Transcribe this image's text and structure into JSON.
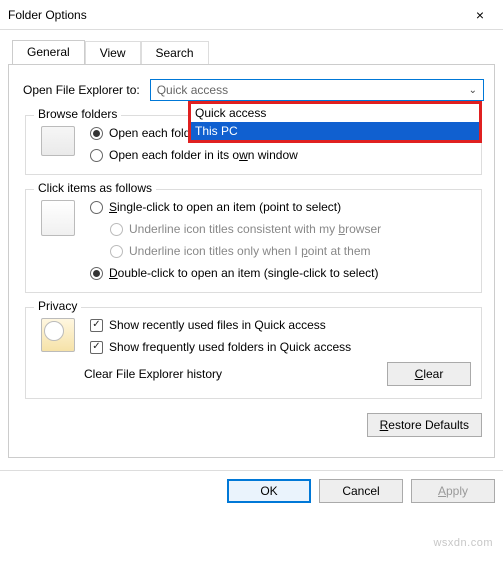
{
  "window": {
    "title": "Folder Options",
    "close_icon": "×"
  },
  "tabs": [
    {
      "label": "General",
      "active": true
    },
    {
      "label": "View",
      "active": false
    },
    {
      "label": "Search",
      "active": false
    }
  ],
  "open_explorer": {
    "label": "Open File Explorer to:",
    "selected": "Quick access",
    "options": [
      {
        "label": "Quick access",
        "highlighted": false
      },
      {
        "label": "This PC",
        "highlighted": true
      }
    ]
  },
  "browse_folders": {
    "legend": "Browse folders",
    "options": [
      {
        "html": "Open each folder in the sa<span class='underline-letter'>m</span>e window",
        "checked": true
      },
      {
        "html": "Open each folder in its o<span class='underline-letter'>w</span>n window",
        "checked": false
      }
    ]
  },
  "click_items": {
    "legend": "Click items as follows",
    "options": [
      {
        "html": "<span class='underline-letter'>S</span>ingle-click to open an item (point to select)",
        "checked": false
      },
      {
        "html": "Underline icon titles consistent with my <span class='underline-letter'>b</span>rowser",
        "sub": true,
        "disabled": true
      },
      {
        "html": "Underline icon titles only when I <span class='underline-letter'>p</span>oint at them",
        "sub": true,
        "disabled": true
      },
      {
        "html": "<span class='underline-letter'>D</span>ouble-click to open an item (single-click to select)",
        "checked": true
      }
    ]
  },
  "privacy": {
    "legend": "Privacy",
    "checks": [
      {
        "label": "Show recently used files in Quick access",
        "checked": true
      },
      {
        "label": "Show frequently used folders in Quick access",
        "checked": true
      }
    ],
    "clear_label": "Clear File Explorer history",
    "clear_button": "Clear"
  },
  "restore_button": "Restore Defaults",
  "footer": {
    "ok": "OK",
    "cancel": "Cancel",
    "apply": "Apply"
  },
  "watermark": "wsxdn.com"
}
